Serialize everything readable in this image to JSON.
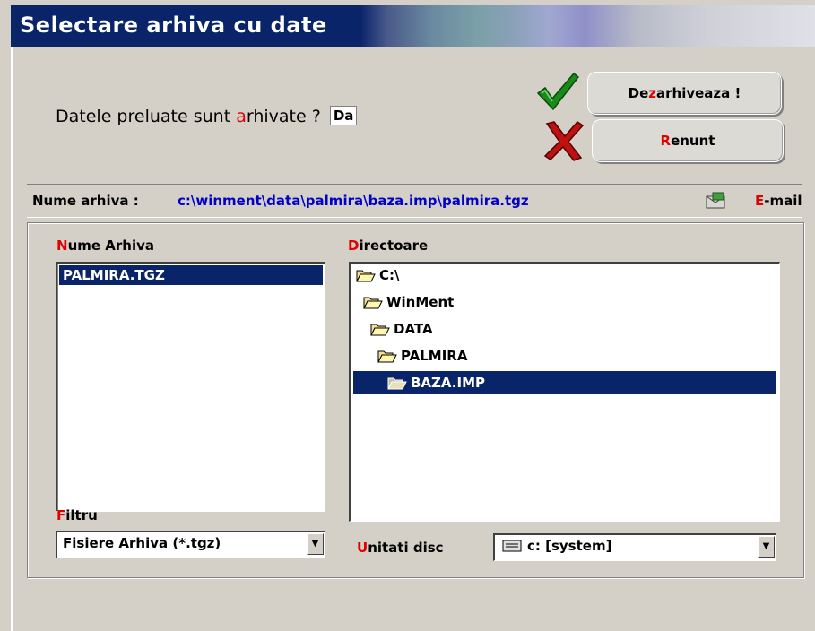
{
  "window": {
    "title": "Selectare arhiva cu date"
  },
  "question": {
    "text_before": "Datele preluate sunt ",
    "text_red": "a",
    "text_after": "rhivate ?",
    "answer": "Da"
  },
  "buttons": {
    "extract": {
      "pre": "De",
      "red": "z",
      "post": "arhiveaza !"
    },
    "cancel": {
      "pre": "",
      "red": "R",
      "post": "enunt"
    }
  },
  "archive_path": {
    "label": "Nume arhiva :",
    "value": "c:\\winment\\data\\palmira\\baza.imp\\palmira.tgz",
    "email_red": "E",
    "email_rest": "-mail"
  },
  "file_list": {
    "label_red": "N",
    "label_rest": "ume Arhiva",
    "items": [
      "PALMIRA.TGZ"
    ]
  },
  "directories": {
    "label_red": "D",
    "label_rest": "irectoare",
    "items": [
      "C:\\",
      "WinMent",
      "DATA",
      "PALMIRA",
      "BAZA.IMP"
    ]
  },
  "filter": {
    "label_red": "F",
    "label_rest": "iltru",
    "value": "Fisiere Arhiva (*.tgz)"
  },
  "drives": {
    "label_red": "U",
    "label_rest": "nitati disc",
    "value": "c: [system]"
  },
  "colors": {
    "titlebar": "#0a246a",
    "selection": "#0a246a",
    "accent_red": "#e00000",
    "path_blue": "#0000c8",
    "dialog_bg": "#d4d0c8"
  }
}
